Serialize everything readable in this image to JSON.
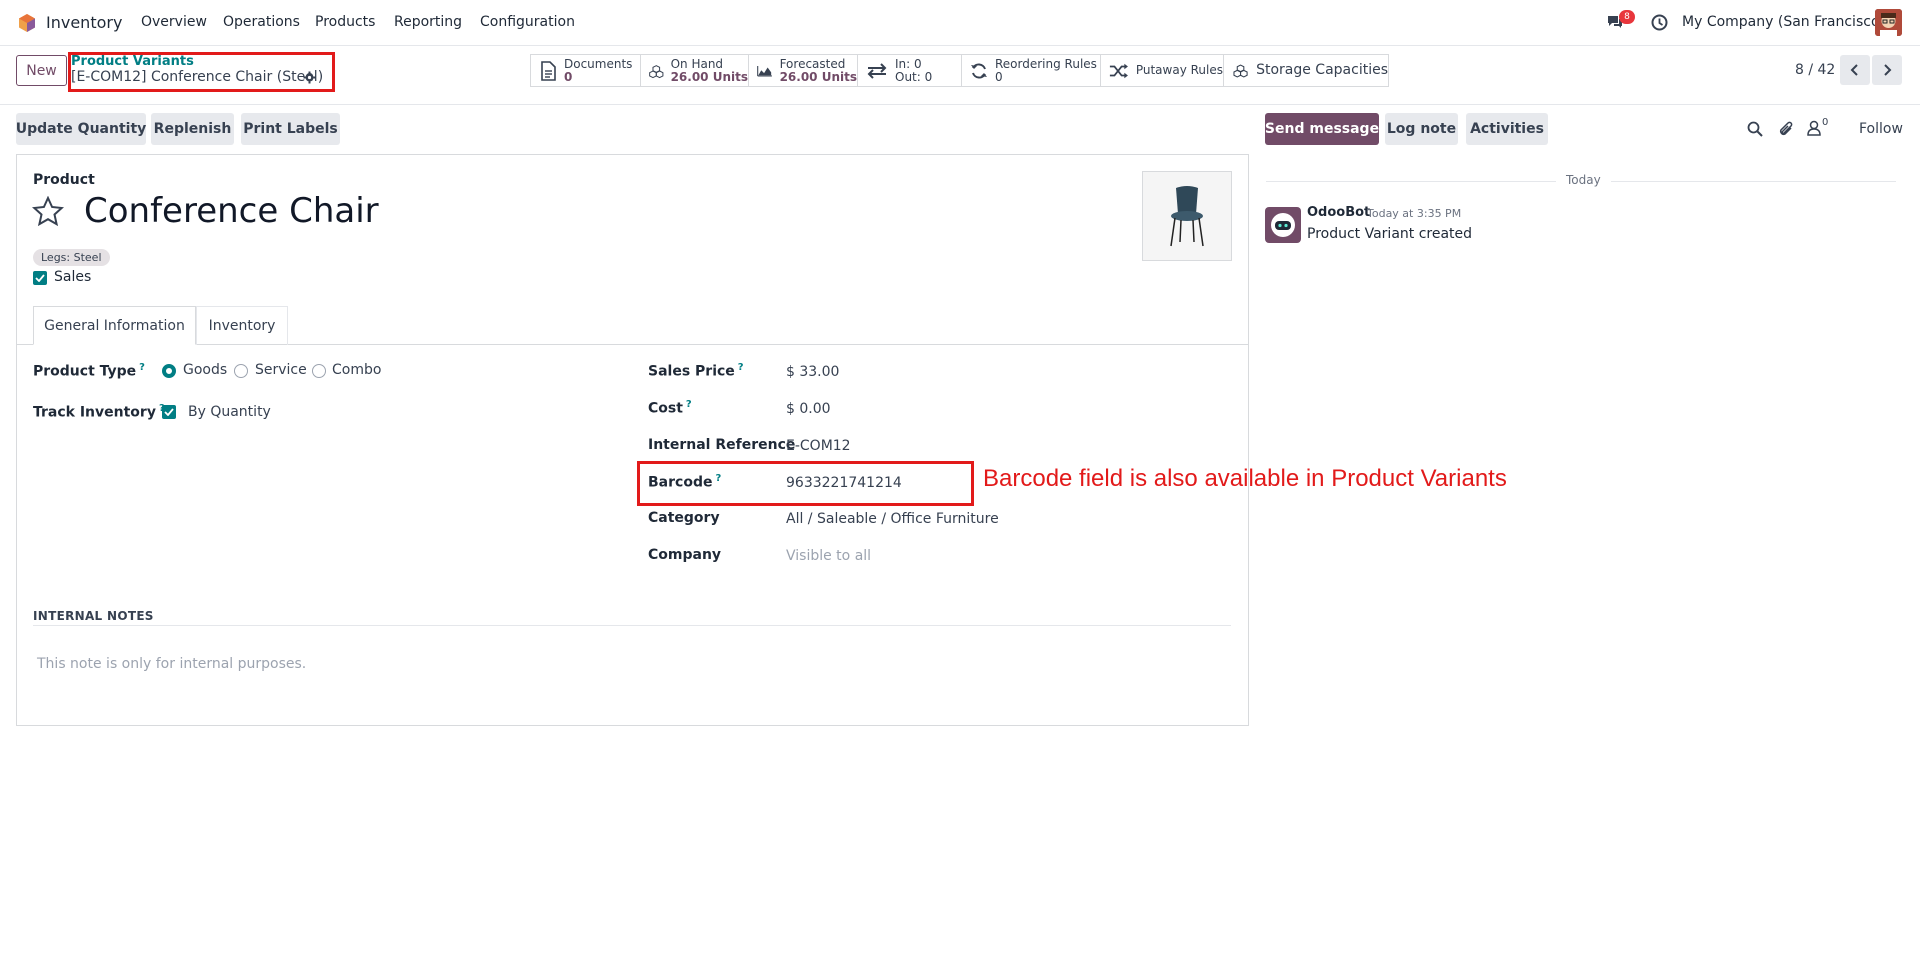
{
  "navbar": {
    "app_name": "Inventory",
    "menu": [
      "Overview",
      "Operations",
      "Products",
      "Reporting",
      "Configuration"
    ],
    "messages_badge": "8",
    "company": "My Company (San Francisco)"
  },
  "control": {
    "new_label": "New",
    "breadcrumb_parent": "Product Variants",
    "breadcrumb_current": "[E-COM12] Conference Chair (Steel)",
    "pager": "8 / 42"
  },
  "smart_buttons": {
    "documents": {
      "label": "Documents",
      "value": "0"
    },
    "on_hand": {
      "label": "On Hand",
      "value": "26.00 Units"
    },
    "forecasted": {
      "label": "Forecasted",
      "value": "26.00 Units"
    },
    "in_out": {
      "in": "In: 0",
      "out": "Out: 0"
    },
    "reordering": {
      "label": "Reordering Rules",
      "value": "0"
    },
    "putaway": {
      "label": "Putaway Rules"
    },
    "storage": {
      "label": "Storage Capacities"
    }
  },
  "actions": {
    "update_quantity": "Update Quantity",
    "replenish": "Replenish",
    "print_labels": "Print Labels"
  },
  "form": {
    "product_label": "Product",
    "name": "Conference Chair",
    "attribute_tag": "Legs: Steel",
    "sales_label": "Sales",
    "tabs": [
      "General Information",
      "Inventory"
    ],
    "product_type_label": "Product Type",
    "product_type_options": [
      "Goods",
      "Service",
      "Combo"
    ],
    "product_type_selected": "Goods",
    "track_inventory_label": "Track Inventory",
    "track_inventory_value": "By Quantity",
    "sales_price_label": "Sales Price",
    "sales_price": "$ 33.00",
    "cost_label": "Cost",
    "cost": "$ 0.00",
    "internal_ref_label": "Internal Reference",
    "internal_ref": "E-COM12",
    "barcode_label": "Barcode",
    "barcode": "9633221741214",
    "category_label": "Category",
    "category": "All / Saleable / Office Furniture",
    "company_label": "Company",
    "company_placeholder": "Visible to all",
    "notes_heading": "INTERNAL NOTES",
    "notes_placeholder": "This note is only for internal purposes."
  },
  "annotation": {
    "text": "Barcode field is also available in Product Variants",
    "color": "#e21a1a"
  },
  "chatter": {
    "send_message": "Send message",
    "log_note": "Log note",
    "activities": "Activities",
    "followers_count": "0",
    "follow": "Follow",
    "date_separator": "Today",
    "message": {
      "author": "OdooBot",
      "time": "Today at 3:35 PM",
      "body": "Product Variant created"
    }
  },
  "colors": {
    "brand": "#714b67",
    "teal": "#017e84",
    "annotation_red": "#e21a1a"
  }
}
